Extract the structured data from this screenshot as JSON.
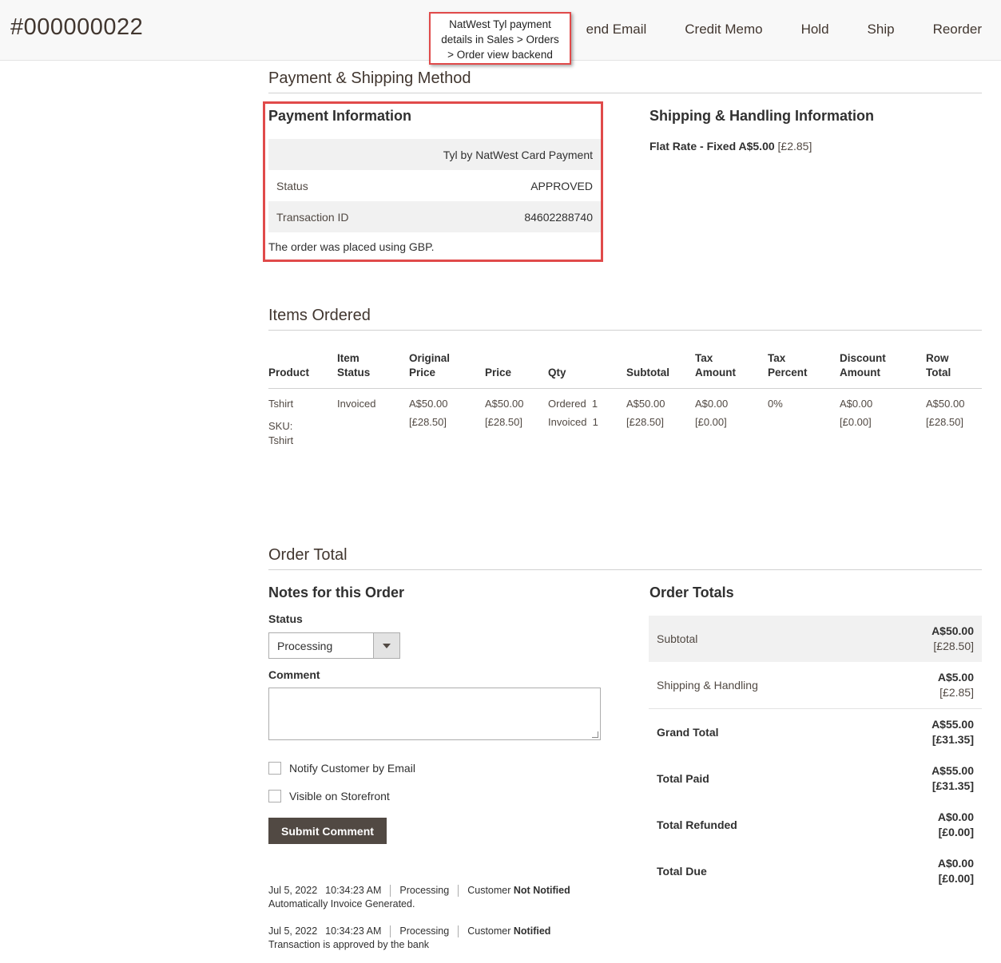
{
  "header": {
    "order_number": "#000000022",
    "actions": [
      "end Email",
      "Credit Memo",
      "Hold",
      "Ship",
      "Reorder"
    ]
  },
  "callout": {
    "line1": "NatWest Tyl payment",
    "line2": "details in Sales > Orders",
    "line3": "> Order view backend"
  },
  "payment_shipping": {
    "title": "Payment & Shipping Method",
    "payment": {
      "title": "Payment Information",
      "method": "Tyl by NatWest Card Payment",
      "status_label": "Status",
      "status_value": "APPROVED",
      "txn_label": "Transaction ID",
      "txn_value": "84602288740",
      "note": "The order was placed using GBP."
    },
    "shipping": {
      "title": "Shipping & Handling Information",
      "method": "Flat Rate - Fixed A$5.00",
      "base": "[£2.85]"
    }
  },
  "items": {
    "title": "Items Ordered",
    "headers": {
      "product": "Product",
      "item_status_1": "Item",
      "item_status_2": "Status",
      "orig_price_1": "Original",
      "orig_price_2": "Price",
      "price": "Price",
      "qty": "Qty",
      "subtotal": "Subtotal",
      "tax_amount_1": "Tax",
      "tax_amount_2": "Amount",
      "tax_percent_1": "Tax",
      "tax_percent_2": "Percent",
      "discount_1": "Discount",
      "discount_2": "Amount",
      "row_total_1": "Row",
      "row_total_2": "Total"
    },
    "row": {
      "product": "Tshirt",
      "sku_label": "SKU:",
      "sku": "Tshirt",
      "status": "Invoiced",
      "orig_price": "A$50.00",
      "orig_price_base": "[£28.50]",
      "price": "A$50.00",
      "price_base": "[£28.50]",
      "qty_ordered": "Ordered  1",
      "qty_invoiced": "Invoiced  1",
      "subtotal": "A$50.00",
      "subtotal_base": "[£28.50]",
      "tax": "A$0.00",
      "tax_base": "[£0.00]",
      "tax_percent": "0%",
      "discount": "A$0.00",
      "discount_base": "[£0.00]",
      "row_total": "A$50.00",
      "row_total_base": "[£28.50]"
    }
  },
  "order_total": {
    "title": "Order Total",
    "notes": {
      "title": "Notes for this Order",
      "status_label": "Status",
      "status_value": "Processing",
      "comment_label": "Comment",
      "notify_label": "Notify Customer by Email",
      "visible_label": "Visible on Storefront",
      "submit_label": "Submit Comment"
    },
    "history": [
      {
        "date": "Jul 5, 2022",
        "time": "10:34:23 AM",
        "status": "Processing",
        "customer": "Customer",
        "notified": "Not Notified",
        "comment": "Automatically Invoice Generated."
      },
      {
        "date": "Jul 5, 2022",
        "time": "10:34:23 AM",
        "status": "Processing",
        "customer": "Customer",
        "notified": "Notified",
        "comment": "Transaction is approved by the bank"
      }
    ],
    "totals": {
      "title": "Order Totals",
      "subtotal_label": "Subtotal",
      "subtotal": "A$50.00",
      "subtotal_base": "[£28.50]",
      "shipping_label": "Shipping & Handling",
      "shipping": "A$5.00",
      "shipping_base": "[£2.85]",
      "grand_label": "Grand Total",
      "grand": "A$55.00",
      "grand_base": "[£31.35]",
      "paid_label": "Total Paid",
      "paid": "A$55.00",
      "paid_base": "[£31.35]",
      "refunded_label": "Total Refunded",
      "refunded": "A$0.00",
      "refunded_base": "[£0.00]",
      "due_label": "Total Due",
      "due": "A$0.00",
      "due_base": "[£0.00]"
    }
  },
  "colors": {
    "highlight": "#e04a4a",
    "button": "#514943",
    "shade": "#f1f1f1"
  }
}
